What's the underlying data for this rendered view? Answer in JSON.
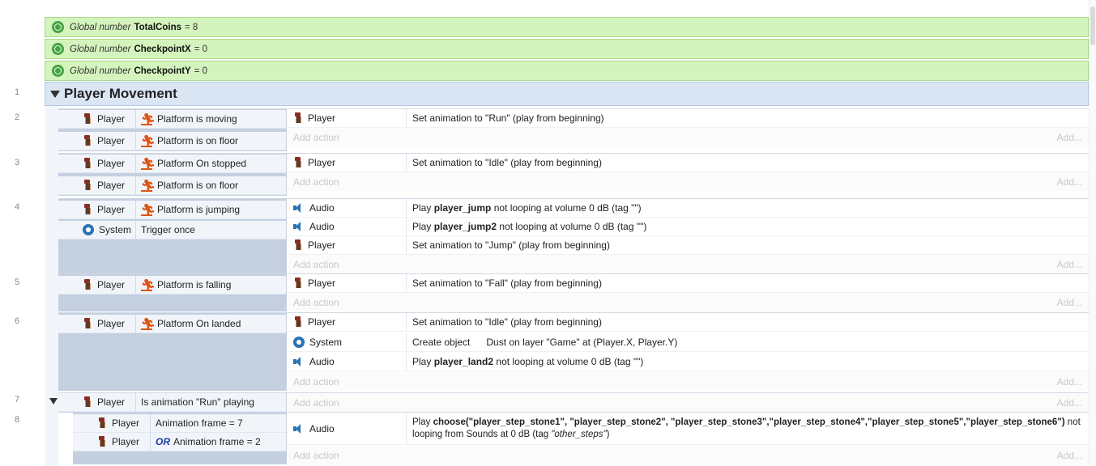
{
  "globals": [
    {
      "kw": "Global number",
      "name": "TotalCoins",
      "value": "= 8"
    },
    {
      "kw": "Global number",
      "name": "CheckpointX",
      "value": "= 0"
    },
    {
      "kw": "Global number",
      "name": "CheckpointY",
      "value": "= 0"
    }
  ],
  "group": {
    "line": "1",
    "title": "Player Movement"
  },
  "labels": {
    "add_action": "Add action",
    "add": "Add..."
  },
  "events": [
    {
      "line": "2",
      "conds": [
        {
          "obj": "Player",
          "text": "Platform is moving"
        },
        {
          "obj": "Player",
          "text": "Platform is on floor"
        }
      ],
      "acts": [
        {
          "obj": "Player",
          "text": "Set animation to \"Run\" (play from beginning)"
        }
      ]
    },
    {
      "line": "3",
      "conds": [
        {
          "obj": "Player",
          "text": "Platform On stopped"
        },
        {
          "obj": "Player",
          "text": "Platform is on floor"
        }
      ],
      "acts": [
        {
          "obj": "Player",
          "text": "Set animation to \"Idle\" (play from beginning)"
        }
      ]
    },
    {
      "line": "4",
      "conds": [
        {
          "obj": "Player",
          "text": "Platform is jumping"
        },
        {
          "obj": "System",
          "text": "Trigger once"
        }
      ],
      "acts": [
        {
          "obj": "Audio",
          "pre": "Play ",
          "b": "player_jump",
          "post": " not looping at volume 0 dB (tag \"\")"
        },
        {
          "obj": "Audio",
          "pre": "Play ",
          "b": "player_jump2",
          "post": " not looping at volume 0 dB (tag \"\")"
        },
        {
          "obj": "Player",
          "text": "Set animation to \"Jump\" (play from beginning)"
        }
      ]
    },
    {
      "line": "5",
      "conds": [
        {
          "obj": "Player",
          "text": "Platform is falling"
        }
      ],
      "acts": [
        {
          "obj": "Player",
          "text": "Set animation to \"Fall\" (play from beginning)"
        }
      ]
    },
    {
      "line": "6",
      "conds": [
        {
          "obj": "Player",
          "text": "Platform On landed"
        }
      ],
      "acts": [
        {
          "obj": "Player",
          "text": "Set animation to \"Idle\" (play from beginning)"
        },
        {
          "obj": "System",
          "text": "Create object      Dust on layer \"Game\" at (Player.X, Player.Y)"
        },
        {
          "obj": "Audio",
          "pre": "Play ",
          "b": "player_land2",
          "post": " not looping at volume 0 dB (tag \"\")"
        }
      ]
    },
    {
      "line": "7",
      "conds": [
        {
          "obj": "Player",
          "text": "Is animation \"Run\" playing"
        }
      ],
      "acts": []
    },
    {
      "line": "8",
      "conds": [
        {
          "obj": "Player",
          "text": "Animation frame = 7"
        },
        {
          "obj": "Player",
          "or": "OR",
          "text": "Animation frame = 2"
        }
      ],
      "acts": [
        {
          "obj": "Audio",
          "pre": "Play ",
          "b": "choose(\"player_step_stone1\", \"player_step_stone2\", \"player_step_stone3\",\"player_step_stone4\",\"player_step_stone5\",\"player_step_stone6\")",
          "post": " not",
          "line2": "looping from Sounds at 0 dB (tag ",
          "tag": "\"other_steps\"",
          "close": ")"
        }
      ]
    }
  ]
}
